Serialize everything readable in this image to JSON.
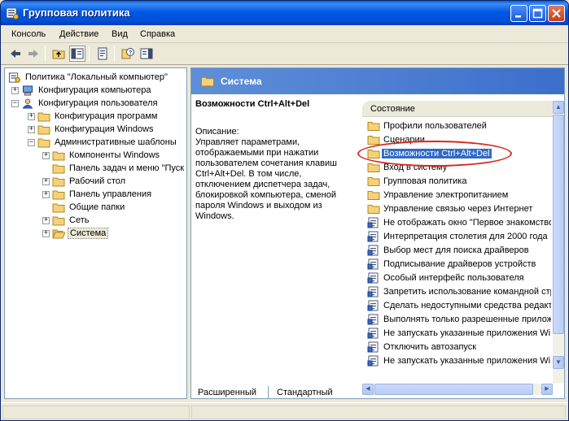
{
  "window": {
    "title": "Групповая политика"
  },
  "menu": {
    "items": [
      "Консоль",
      "Действие",
      "Вид",
      "Справка"
    ]
  },
  "tree": {
    "items": [
      {
        "label": "Политика \"Локальный компьютер\"",
        "level": 0,
        "expander": "",
        "icon": "policy-icon"
      },
      {
        "label": "Конфигурация компьютера",
        "level": 1,
        "expander": "+",
        "icon": "computer-icon"
      },
      {
        "label": "Конфигурация пользователя",
        "level": 1,
        "expander": "−",
        "icon": "user-icon"
      },
      {
        "label": "Конфигурация программ",
        "level": 2,
        "expander": "+",
        "icon": "folder-icon"
      },
      {
        "label": "Конфигурация Windows",
        "level": 2,
        "expander": "+",
        "icon": "folder-icon"
      },
      {
        "label": "Административные шаблоны",
        "level": 2,
        "expander": "−",
        "icon": "folder-icon"
      },
      {
        "label": "Компоненты Windows",
        "level": 3,
        "expander": "+",
        "icon": "folder-icon"
      },
      {
        "label": "Панель задач и меню \"Пуск",
        "level": 3,
        "expander": "",
        "icon": "folder-icon"
      },
      {
        "label": "Рабочий стол",
        "level": 3,
        "expander": "+",
        "icon": "folder-icon"
      },
      {
        "label": "Панель управления",
        "level": 3,
        "expander": "+",
        "icon": "folder-icon"
      },
      {
        "label": "Общие папки",
        "level": 3,
        "expander": "",
        "icon": "folder-icon"
      },
      {
        "label": "Сеть",
        "level": 3,
        "expander": "+",
        "icon": "folder-icon"
      },
      {
        "label": "Система",
        "level": 3,
        "expander": "+",
        "icon": "folder-open-icon",
        "selected": true
      }
    ]
  },
  "panel": {
    "header": "Система",
    "desc_title": "Возможности Ctrl+Alt+Del",
    "desc_label": "Описание:",
    "desc_text": "Управляет параметрами, отображаемыми при нажатии пользователем сочетания клавиш Ctrl+Alt+Del. В том числе, отключением диспетчера задач, блокировкой компьютера, сменой пароля Windows и выходом из Windows."
  },
  "list": {
    "column_header": "Состояние",
    "rows": [
      {
        "label": "Профили пользователей",
        "icon": "folder-icon"
      },
      {
        "label": "Сценарии",
        "icon": "folder-icon"
      },
      {
        "label": "Возможности Ctrl+Alt+Del",
        "icon": "folder-icon",
        "selected": true
      },
      {
        "label": "Вход в систему",
        "icon": "folder-icon"
      },
      {
        "label": "Групповая политика",
        "icon": "folder-icon"
      },
      {
        "label": "Управление электропитанием",
        "icon": "folder-icon"
      },
      {
        "label": "Управление связью через Интернет",
        "icon": "folder-icon"
      },
      {
        "label": "Не отображать окно \"Первое знакомство",
        "icon": "setting-icon"
      },
      {
        "label": "Интерпретация столетия для 2000 года",
        "icon": "setting-icon"
      },
      {
        "label": "Выбор мест для поиска драйверов",
        "icon": "setting-icon"
      },
      {
        "label": "Подписывание драйверов устройств",
        "icon": "setting-icon"
      },
      {
        "label": "Особый интерфейс пользователя",
        "icon": "setting-icon"
      },
      {
        "label": "Запретить использование командной стр",
        "icon": "setting-icon"
      },
      {
        "label": "Сделать недоступными средства редакт",
        "icon": "setting-icon"
      },
      {
        "label": "Выполнять только разрешенные прилож",
        "icon": "setting-icon"
      },
      {
        "label": "Не запускать указанные приложения Wi",
        "icon": "setting-icon"
      },
      {
        "label": "Отключить автозапуск",
        "icon": "setting-icon"
      },
      {
        "label": "Не запускать указанные приложения Wi",
        "icon": "setting-icon"
      }
    ]
  },
  "tabs": {
    "extended": "Расширенный",
    "standard": "Стандартный"
  },
  "colors": {
    "titlebar": "#0058e6",
    "selection": "#316ac5",
    "highlight_ring": "#d32b1e",
    "folder": "#f5d27a"
  }
}
